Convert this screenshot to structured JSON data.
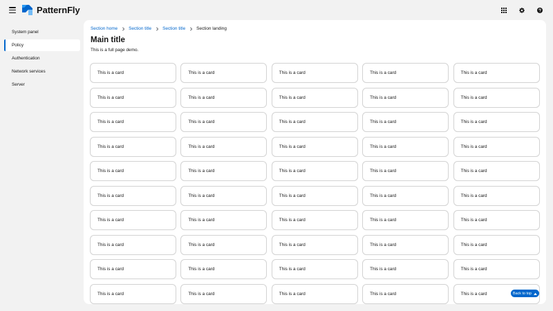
{
  "masthead": {
    "brand": "PatternFly",
    "tools": [
      {
        "icon": "grid-icon"
      },
      {
        "icon": "gear-icon"
      },
      {
        "icon": "help-icon"
      }
    ]
  },
  "sidebar": {
    "items": [
      {
        "label": "System panel",
        "current": false
      },
      {
        "label": "Policy",
        "current": true
      },
      {
        "label": "Authentication",
        "current": false
      },
      {
        "label": "Network services",
        "current": false
      },
      {
        "label": "Server",
        "current": false
      }
    ]
  },
  "breadcrumb": [
    "Section home",
    "Section title",
    "Section title",
    "Section landing"
  ],
  "main": {
    "title": "Main title",
    "description": "This is a full page demo."
  },
  "cards": {
    "label": "This is a card",
    "rows": 10,
    "columns": 5
  },
  "back_to_top": "Back to top",
  "colors": {
    "accent": "#0066cc",
    "background": "#f2f2f2",
    "surface": "#ffffff",
    "border": "#d2d2d2",
    "text": "#151515"
  }
}
